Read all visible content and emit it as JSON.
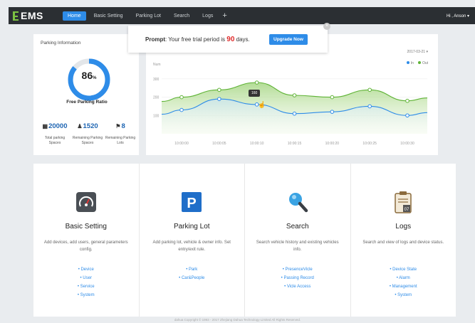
{
  "app": {
    "name": "EMS"
  },
  "nav": {
    "items": [
      {
        "label": "Home",
        "active": true
      },
      {
        "label": "Basic Setting"
      },
      {
        "label": "Parking Lot"
      },
      {
        "label": "Search"
      },
      {
        "label": "Logs"
      }
    ],
    "add_label": "+",
    "user": "Hi , Anson"
  },
  "prompt": {
    "label": "Prompt",
    "text_before": ": Your free trial period is ",
    "days": "90",
    "text_after": " days.",
    "button": "Upgrade Now"
  },
  "parking_info": {
    "title": "Parking Information",
    "ratio": "86",
    "ratio_unit": "%",
    "ratio_fraction": 0.86,
    "ratio_label": "Free Parking Ratio",
    "stats": [
      {
        "icon": "building-icon",
        "glyph": "▦",
        "value": "20000",
        "label": "Total parking Spaces"
      },
      {
        "icon": "person-icon",
        "glyph": "♟",
        "value": "1520",
        "label": "Remaining Parking Spaces"
      },
      {
        "icon": "flag-icon",
        "glyph": "⚑",
        "value": "8",
        "label": "Remaining Parking Lots"
      }
    ]
  },
  "chart": {
    "date": "2017-03-21",
    "ylabel": "Num",
    "tooltip": "160",
    "legend": [
      {
        "name": "In",
        "color": "#2e8ce8"
      },
      {
        "name": "Out",
        "color": "#5fb336"
      }
    ]
  },
  "chart_data": {
    "type": "area",
    "x": [
      "10:00:00",
      "10:00:05",
      "10:00:10",
      "10:00:15",
      "10:00:20",
      "10:00:25",
      "10:00:30"
    ],
    "series": [
      {
        "name": "Out",
        "color": "#5fb336",
        "values": [
          200,
          240,
          280,
          210,
          200,
          240,
          180
        ]
      },
      {
        "name": "In",
        "color": "#2e8ce8",
        "values": [
          130,
          190,
          160,
          110,
          120,
          150,
          100
        ]
      }
    ],
    "ylim": [
      0,
      350
    ],
    "yticks": [
      100,
      200,
      300
    ],
    "grid": true,
    "legend_position": "top-right"
  },
  "modules": [
    {
      "name": "basic-setting",
      "icon": "speedometer-icon",
      "title": "Basic Setting",
      "desc": "Add devices, add users, general parameters config.",
      "links": [
        "Device",
        "User",
        "Service",
        "System"
      ]
    },
    {
      "name": "parking-lot",
      "icon": "parking-icon",
      "title": "Parking Lot",
      "desc": "Add parking lot, vehicle & owner info. Set entry/exit rule.",
      "links": [
        "Park",
        "Car&People"
      ]
    },
    {
      "name": "search",
      "icon": "magnifier-icon",
      "title": "Search",
      "desc": "Search vehicle history and existing vehicles info.",
      "links": [
        "PresenceVicle",
        "Passing Record",
        "Vicle Access"
      ]
    },
    {
      "name": "logs",
      "icon": "clipboard-icon",
      "title": "Logs",
      "desc": "Search and view of logs and device status.",
      "links": [
        "Device State",
        "Alarm",
        "Management",
        "System"
      ]
    }
  ],
  "footer": "dahua  Copyright © 1993 - 2017 Zhejiang Dahua Technology Limited All Rights Reserved."
}
